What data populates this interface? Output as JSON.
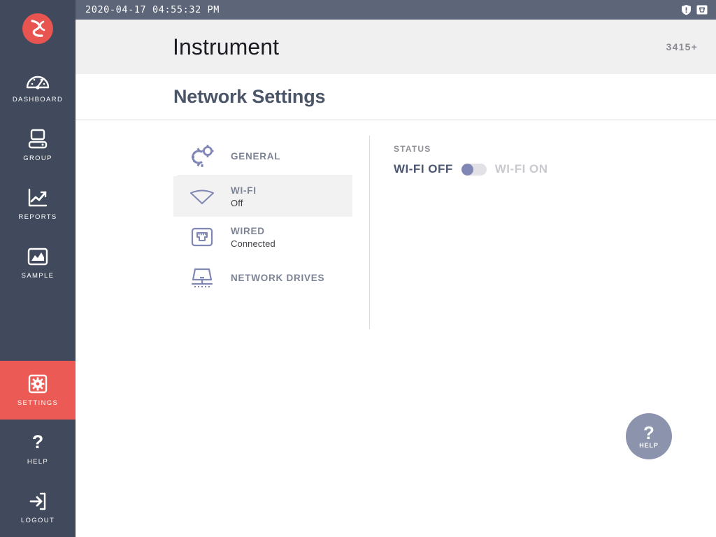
{
  "statusbar": {
    "datetime": "2020-04-17 04:55:32 PM",
    "icons": [
      {
        "name": "alert-shield-icon"
      },
      {
        "name": "network-status-icon"
      }
    ]
  },
  "header": {
    "instrument_title": "Instrument",
    "instrument_id": "3415+"
  },
  "page": {
    "title": "Network Settings"
  },
  "sidebar": {
    "logo_name": "app-logo",
    "items": [
      {
        "label": "DASHBOARD",
        "icon": "dashboard-gauge-icon",
        "active": false
      },
      {
        "label": "GROUP",
        "icon": "computer-icon",
        "active": false
      },
      {
        "label": "REPORTS",
        "icon": "line-chart-icon",
        "active": false
      },
      {
        "label": "SAMPLE",
        "icon": "sample-image-icon",
        "active": false
      },
      {
        "label": "SETTINGS",
        "icon": "gear-square-icon",
        "active": true
      },
      {
        "label": "HELP",
        "icon": "question-mark-icon",
        "active": false
      },
      {
        "label": "LOGOUT",
        "icon": "logout-arrow-icon",
        "active": false
      }
    ]
  },
  "settings_list": [
    {
      "label": "GENERAL",
      "sub": "",
      "icon": "gears-icon",
      "selected": false
    },
    {
      "label": "WI-FI",
      "sub": "Off",
      "icon": "wifi-icon",
      "selected": true
    },
    {
      "label": "WIRED",
      "sub": "Connected",
      "icon": "ethernet-port-icon",
      "selected": false
    },
    {
      "label": "NETWORK DRIVES",
      "sub": "",
      "icon": "network-drive-icon",
      "selected": false
    }
  ],
  "detail": {
    "status_label": "STATUS",
    "toggle_off_label": "WI-FI OFF",
    "toggle_on_label": "WI-FI ON",
    "toggle_state": "off"
  },
  "help_button": {
    "symbol": "?",
    "label": "HELP"
  },
  "colors": {
    "sidebar_bg": "#414a5c",
    "statusbar_bg": "#5d6579",
    "accent_red": "#eb5a54",
    "title_slate": "#4b5568",
    "toggle_knob": "#8087b5",
    "icon_blue": "#8087b5",
    "help_fab": "#8c93ad"
  }
}
